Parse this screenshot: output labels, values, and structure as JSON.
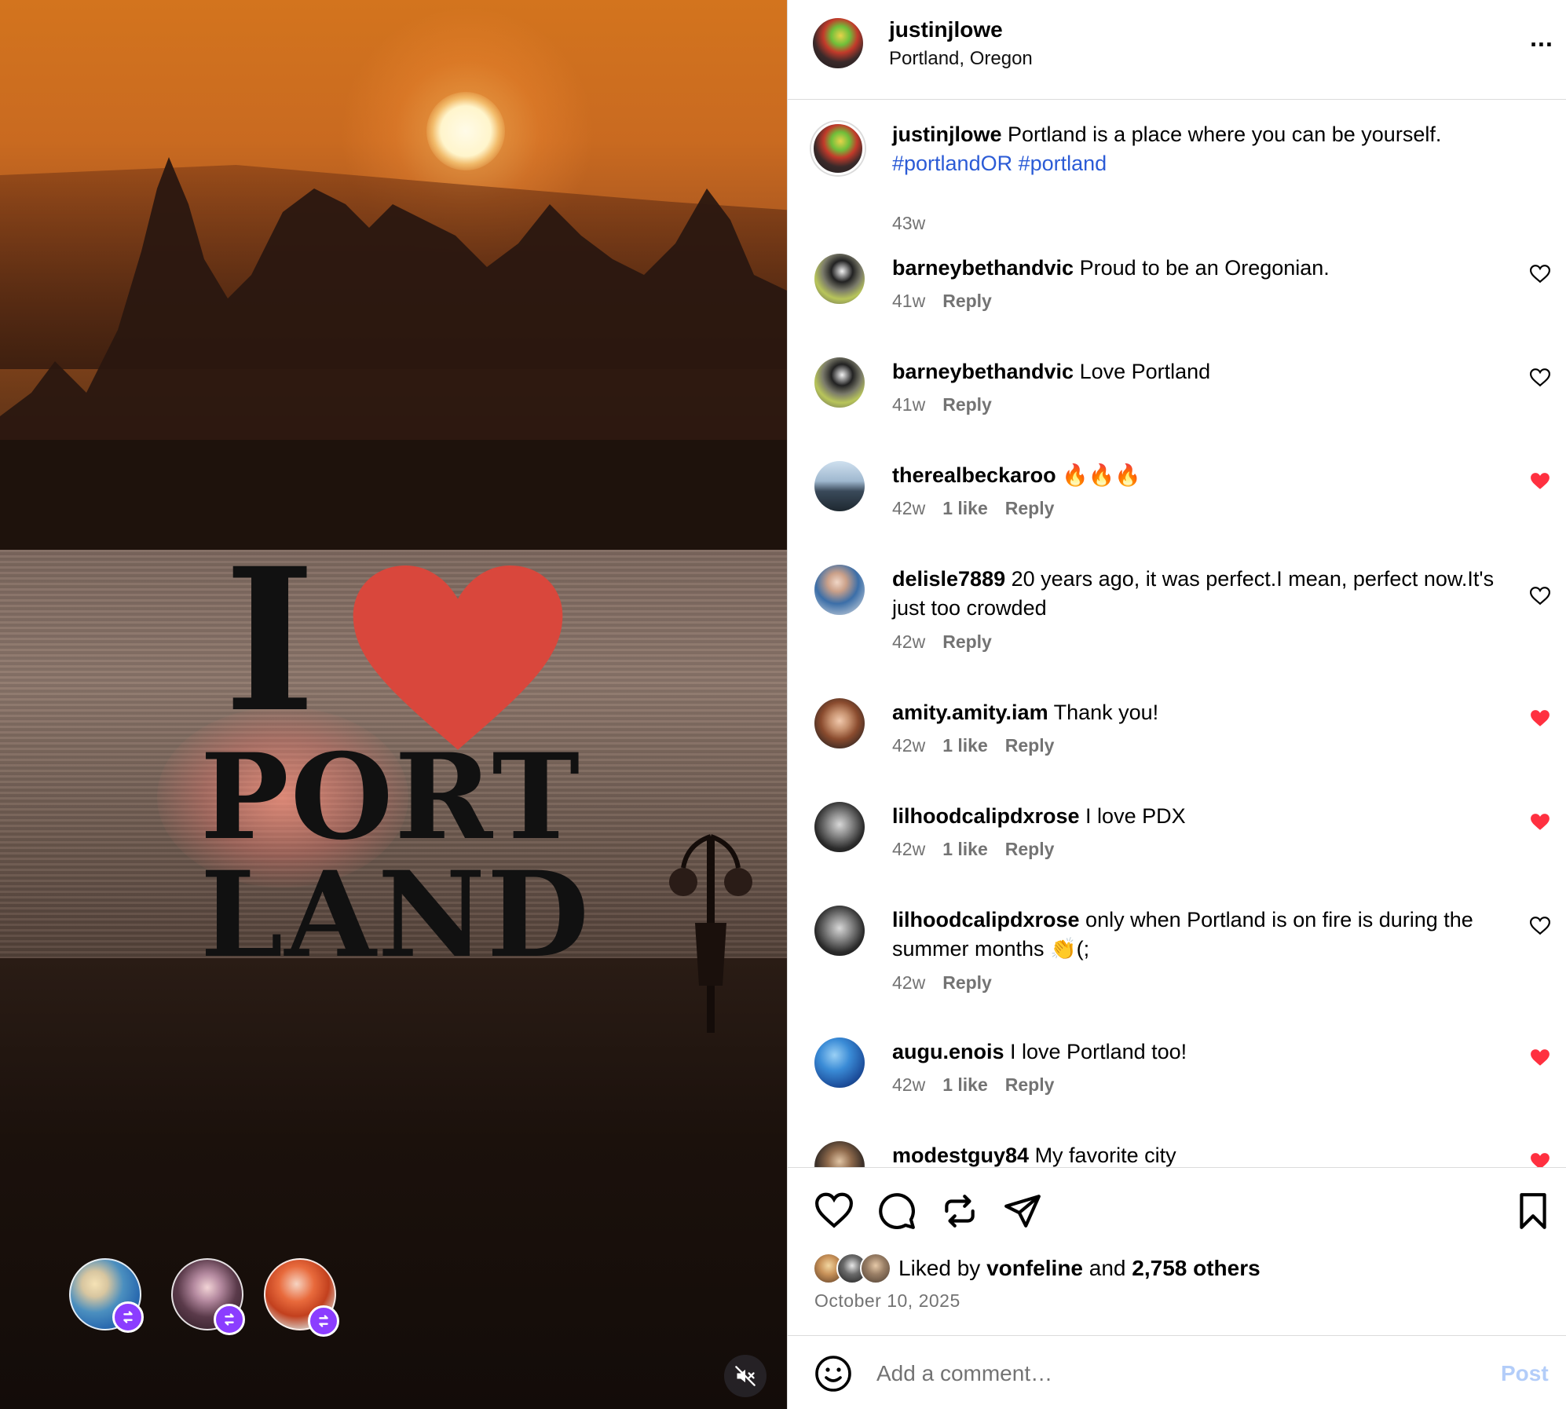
{
  "media": {
    "overlay_line1": "I",
    "overlay_line2": "PORT",
    "overlay_line3": "LAND",
    "heart_color": "#d9473c",
    "reposters": [
      {
        "name": "reposter-1"
      },
      {
        "name": "reposter-2"
      },
      {
        "name": "reposter-3"
      }
    ],
    "repost_badge_color": "#8b3dff",
    "mute_icon": "volume-muted-icon"
  },
  "header": {
    "username": "justinjlowe",
    "location": "Portland, Oregon",
    "more_icon": "more-horizontal-icon",
    "more_label": "..."
  },
  "caption": {
    "username": "justinjlowe",
    "text": " Portland is a place where you can be yourself.",
    "hashtags": "#portlandOR #portland",
    "time": "43w"
  },
  "comments": [
    {
      "username": "barneybethandvic",
      "text": " Proud to be an Oregonian.",
      "time": "41w",
      "likes": "",
      "reply": "Reply",
      "liked": false
    },
    {
      "username": "barneybethandvic",
      "text": " Love Portland",
      "time": "41w",
      "likes": "",
      "reply": "Reply",
      "liked": false
    },
    {
      "username": "therealbeckaroo",
      "text": " 🔥🔥🔥",
      "time": "42w",
      "likes": "1 like",
      "reply": "Reply",
      "liked": true
    },
    {
      "username": "delisle7889",
      "text": " 20 years ago, it was perfect.I mean, perfect now.It's just too crowded",
      "time": "42w",
      "likes": "",
      "reply": "Reply",
      "liked": false
    },
    {
      "username": "amity.amity.iam",
      "text": " Thank you!",
      "time": "42w",
      "likes": "1 like",
      "reply": "Reply",
      "liked": true
    },
    {
      "username": "lilhoodcalipdxrose",
      "text": " I love PDX",
      "time": "42w",
      "likes": "1 like",
      "reply": "Reply",
      "liked": true
    },
    {
      "username": "lilhoodcalipdxrose",
      "text": " only when Portland is on fire is during the summer months 👏(;",
      "time": "42w",
      "likes": "",
      "reply": "Reply",
      "liked": false
    },
    {
      "username": "augu.enois",
      "text": " I love Portland too!",
      "time": "42w",
      "likes": "1 like",
      "reply": "Reply",
      "liked": true
    },
    {
      "username": "modestguy84",
      "text": " My favorite city",
      "time": "",
      "likes": "",
      "reply": "",
      "liked": true
    }
  ],
  "actions": {
    "like_icon": "heart-outline-icon",
    "comment_icon": "comment-icon",
    "repost_icon": "repost-icon",
    "share_icon": "send-icon",
    "save_icon": "bookmark-icon",
    "liked_by_prefix": "Liked by ",
    "liked_by_user": "vonfeline",
    "liked_by_and": " and ",
    "liked_by_others": "2,758 others",
    "date": "October 10, 2025"
  },
  "add_comment": {
    "placeholder": "Add a comment…",
    "post_label": "Post",
    "emoji_icon": "smiley-icon"
  },
  "colors": {
    "liked_heart": "#ff3040",
    "hashtag": "#2b5bd6",
    "post_disabled": "#b3cdf9",
    "muted_text": "#737373"
  }
}
